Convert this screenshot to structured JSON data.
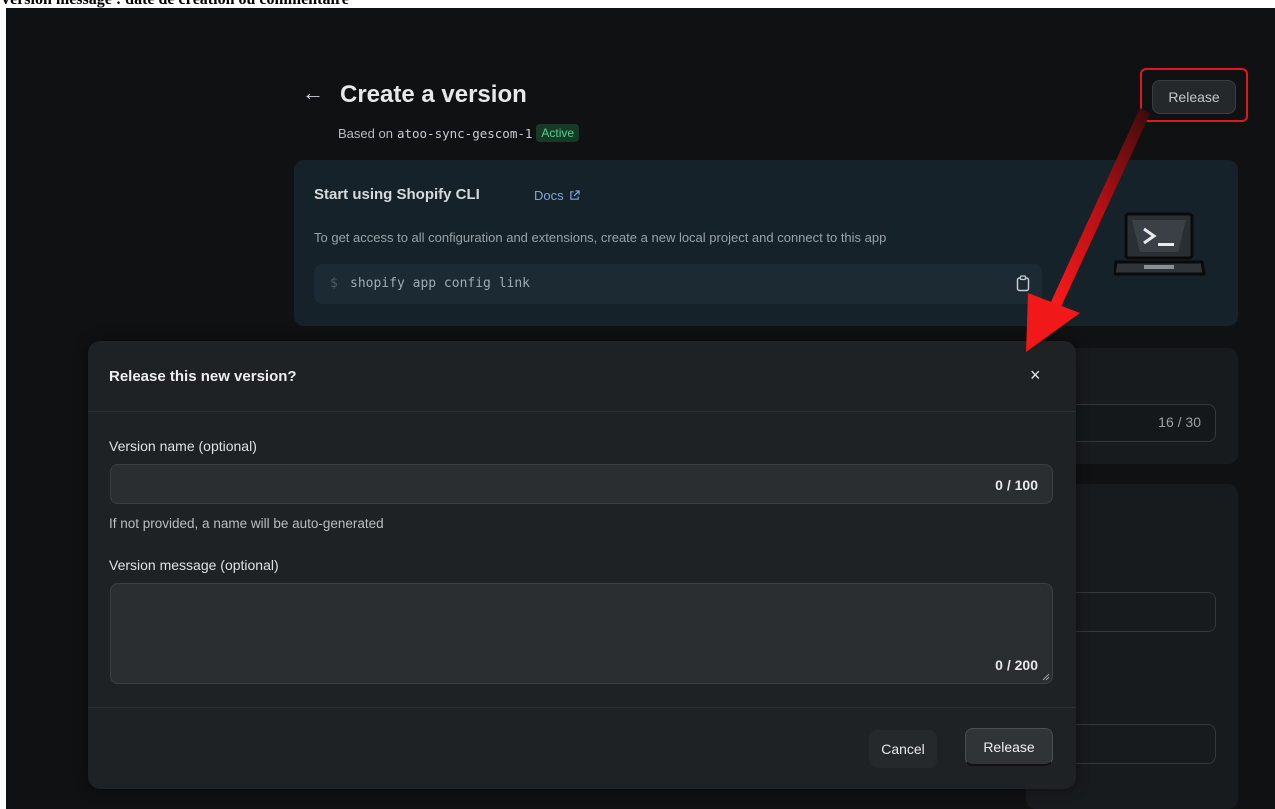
{
  "caption": "Version message : date de création ou commentaire",
  "header": {
    "back_icon": "←",
    "title": "Create a version",
    "based_on_label": "Based on",
    "based_on_value": "atoo-sync-gescom-1",
    "status_badge": "Active",
    "release_button": "Release"
  },
  "cli_card": {
    "title": "Start using Shopify CLI",
    "docs_link": "Docs",
    "description": "To get access to all configuration and extensions, create a new local project and connect to this app",
    "prompt": "$",
    "command": "shopify app config link"
  },
  "background": {
    "counter": "16 / 30"
  },
  "modal": {
    "title": "Release this new version?",
    "close_icon": "×",
    "version_name_label": "Version name (optional)",
    "version_name_value": "",
    "version_name_counter": "0 / 100",
    "version_name_help": "If not provided, a name will be auto-generated",
    "version_message_label": "Version message (optional)",
    "version_message_value": "",
    "version_message_counter": "0 / 200",
    "cancel_button": "Cancel",
    "release_button": "Release"
  },
  "colors": {
    "highlight": "#e0181d",
    "active_badge_text": "#53d08a",
    "page_background": "#101112",
    "modal_background": "#1e2224"
  }
}
